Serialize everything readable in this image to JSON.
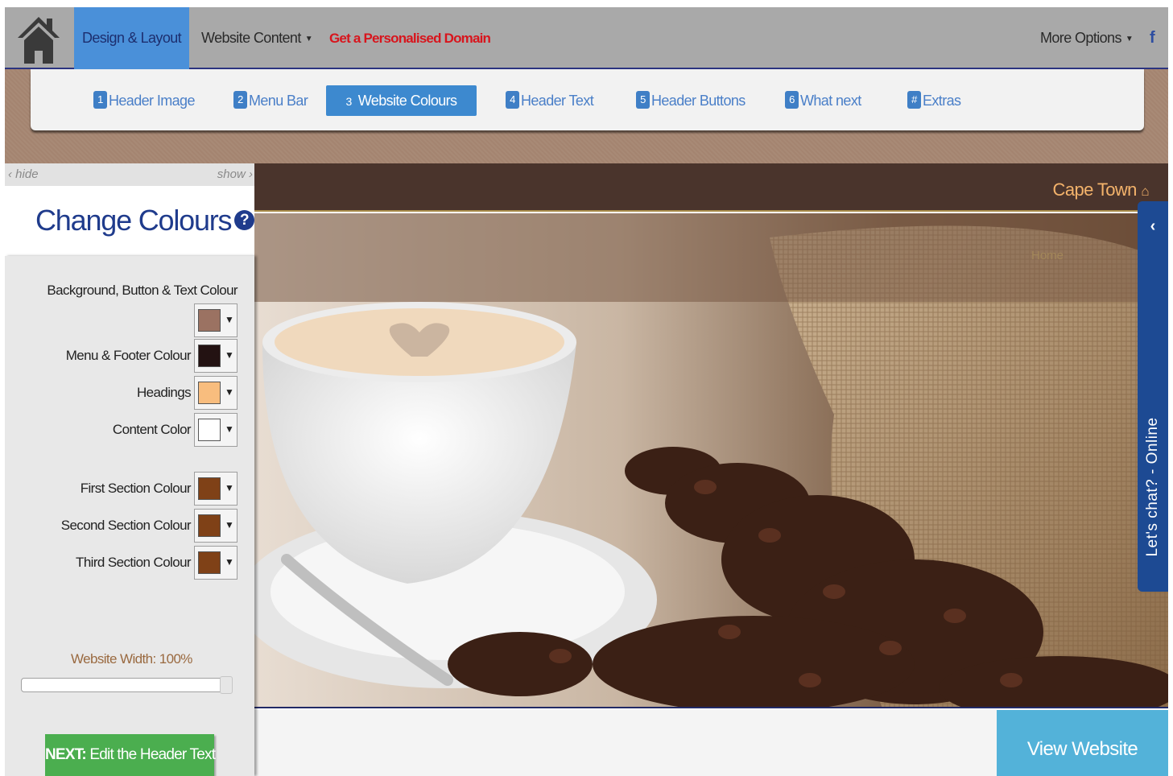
{
  "topnav": {
    "design_layout": "Design & Layout",
    "website_content": "Website Content",
    "personalised_domain": "Get a Personalised Domain",
    "more_options": "More Options",
    "facebook": "f"
  },
  "steps": [
    {
      "num": "1",
      "label": "Header Image"
    },
    {
      "num": "2",
      "label": "Menu Bar"
    },
    {
      "num": "3",
      "label": "Website Colours"
    },
    {
      "num": "4",
      "label": "Header Text"
    },
    {
      "num": "5",
      "label": "Header Buttons"
    },
    {
      "num": "6",
      "label": "What next"
    },
    {
      "num": "#",
      "label": "Extras"
    }
  ],
  "panel": {
    "hide": "hide",
    "show": "show",
    "title": "Change Colours",
    "help": "?",
    "rows": [
      {
        "label": "Background, Button & Text Colour",
        "color": "#9b7262"
      },
      {
        "label": "Menu & Footer Colour",
        "color": "#231212"
      },
      {
        "label": "Headings",
        "color": "#f8bd7e"
      },
      {
        "label": "Content Color",
        "color": "#ffffff"
      },
      {
        "label": "First Section Colour",
        "color": "#7f4117"
      },
      {
        "label": "Second Section Colour",
        "color": "#7f4117"
      },
      {
        "label": "Third Section Colour",
        "color": "#7f4117"
      }
    ],
    "width_label": "Website Width:",
    "width_value": "100%",
    "width_fraction": 1.0,
    "next_bold": "NEXT:",
    "next_text": "Edit the Header Text"
  },
  "preview": {
    "location": "Cape Town",
    "home_link": "Home",
    "view_button": "View Website"
  },
  "chat": {
    "label": "Let's chat? - Online"
  },
  "colors": {
    "nav_active": "#4a90d9",
    "step_active": "#3d89cf",
    "accent_red": "#d8151d",
    "next_green": "#4bae4f",
    "view_blue": "#53b2d9",
    "chat_blue": "#1d4a93"
  }
}
